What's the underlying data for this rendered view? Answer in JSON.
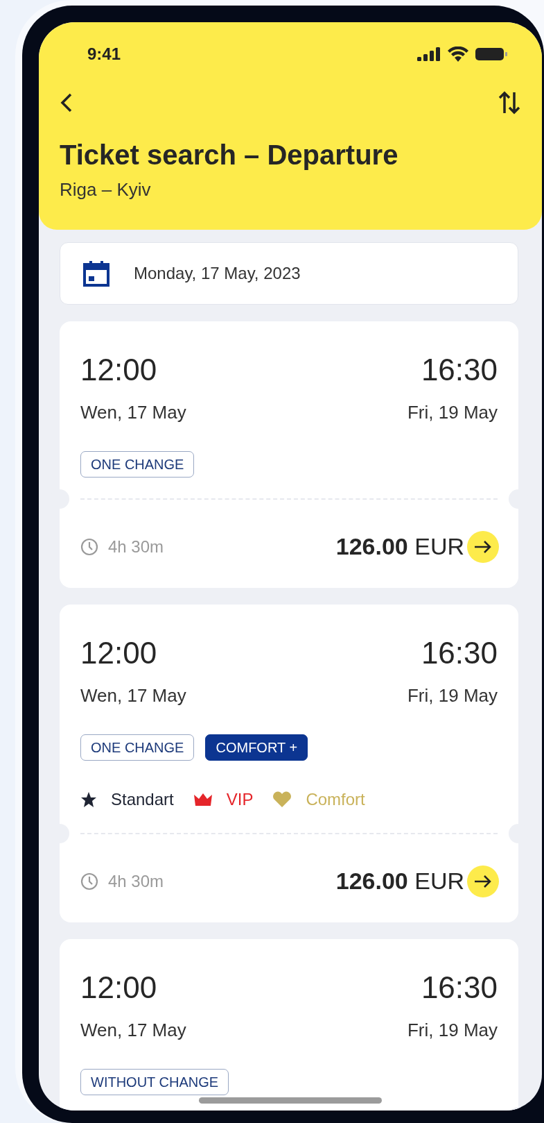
{
  "status_bar": {
    "time": "9:41"
  },
  "header": {
    "title": "Ticket search – Departure",
    "subtitle": "Riga – Kyiv"
  },
  "date_field": {
    "value": "Monday, 17 May, 2023"
  },
  "tickets": [
    {
      "depart_time": "12:00",
      "depart_date": "Wen, 17 May",
      "arrive_time": "16:30",
      "arrive_date": "Fri, 19 May",
      "tags": [
        {
          "label": "ONE CHANGE",
          "kind": "outline"
        }
      ],
      "duration": "4h 30m",
      "price": "126.00",
      "currency": "EUR"
    },
    {
      "depart_time": "12:00",
      "depart_date": "Wen, 17 May",
      "arrive_time": "16:30",
      "arrive_date": "Fri, 19 May",
      "tags": [
        {
          "label": "ONE CHANGE",
          "kind": "outline"
        },
        {
          "label": "COMFORT +",
          "kind": "filled"
        }
      ],
      "classes": [
        {
          "label": "Standart",
          "kind": "star",
          "color": "#1f2433"
        },
        {
          "label": "VIP",
          "kind": "crown",
          "color": "#e5252a"
        },
        {
          "label": "Comfort",
          "kind": "heart",
          "color": "#c9b25a"
        }
      ],
      "duration": "4h 30m",
      "price": "126.00",
      "currency": "EUR"
    },
    {
      "depart_time": "12:00",
      "depart_date": "Wen, 17 May",
      "arrive_time": "16:30",
      "arrive_date": "Fri, 19 May",
      "tags": [
        {
          "label": "WITHOUT CHANGE",
          "kind": "outline"
        }
      ]
    }
  ]
}
